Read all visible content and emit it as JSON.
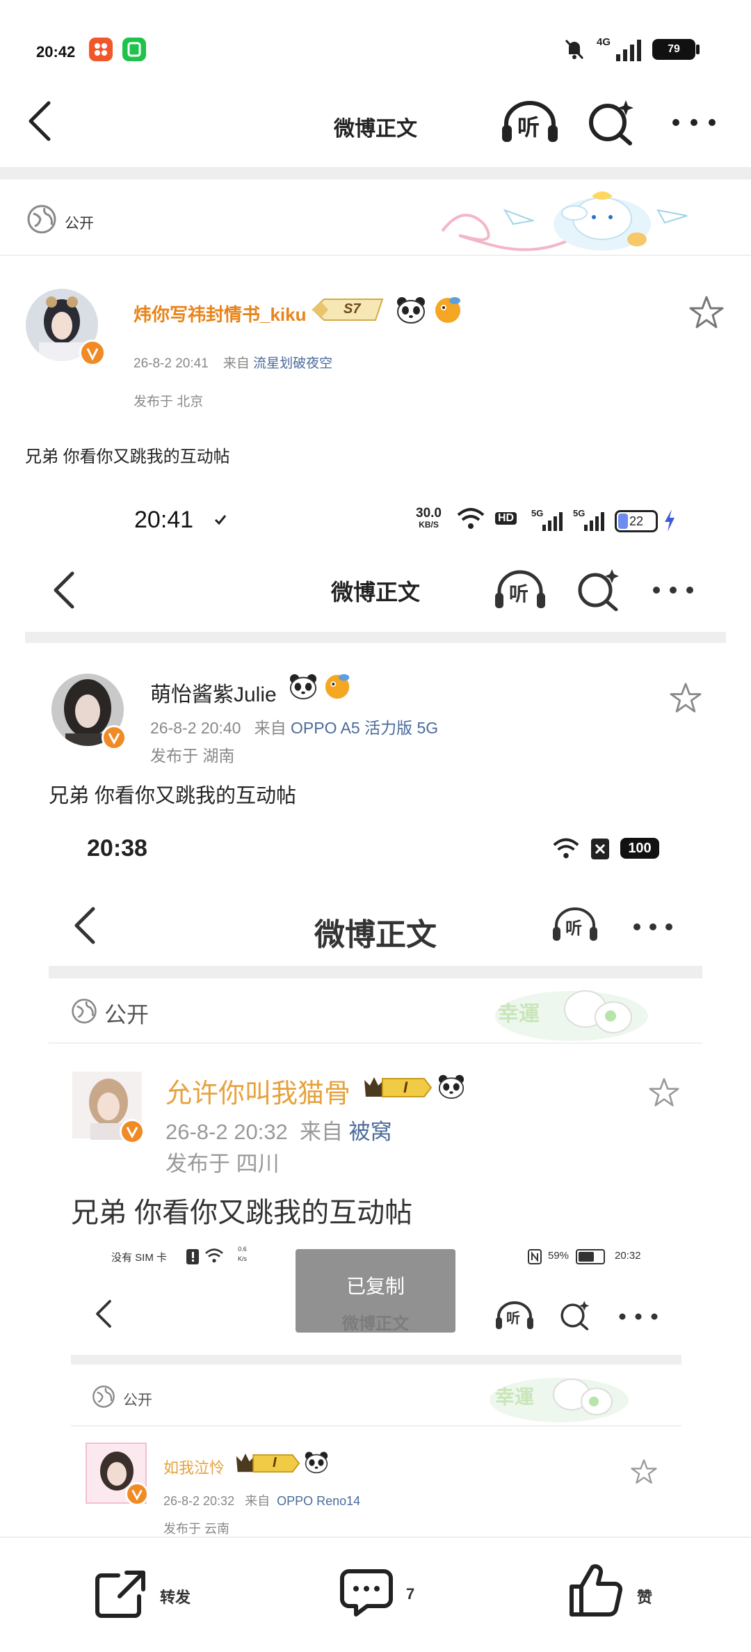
{
  "status_bar": {
    "time": "20:42",
    "network": "4G",
    "battery": "79"
  },
  "header": {
    "title": "微博正文",
    "listen_label": "听"
  },
  "visibility": {
    "label": "公开"
  },
  "post": {
    "author": "炜你写祎封情书_kiku",
    "level_badge": "S7",
    "date": "26-8-2 20:41",
    "from_label": "来自",
    "source": "流星划破夜空",
    "location": "发布于 北京",
    "text": "兄弟 你看你又跳我的互动帖"
  },
  "screenshot1": {
    "time": "20:41",
    "speed": "30.0",
    "speed_unit": "KB/S",
    "hd": "HD",
    "net1": "5G",
    "net2": "5G",
    "battery": "22",
    "title": "微博正文",
    "listen_label": "听",
    "author": "萌怡酱紫Julie",
    "date": "26-8-2 20:40",
    "from_label": "来自",
    "source": "OPPO A5 活力版 5G",
    "location": "发布于 湖南",
    "text": "兄弟 你看你又跳我的互动帖"
  },
  "screenshot2": {
    "time": "20:38",
    "battery": "100",
    "title": "微博正文",
    "listen_label": "听",
    "public_label": "公开",
    "sticker_text": "幸運",
    "author": "允许你叫我猫骨",
    "level_badge": "I",
    "date": "26-8-2 20:32",
    "from_label": "来自",
    "source": "被窝",
    "location": "发布于 四川",
    "text": "兄弟 你看你又跳我的互动帖"
  },
  "screenshot3": {
    "no_sim": "没有 SIM 卡",
    "speed": "0.6",
    "speed_unit": "K/s",
    "battery": "59%",
    "time": "20:32",
    "title": "微博正文",
    "listen_label": "听",
    "public_label": "公开",
    "sticker_text": "幸運",
    "author": "如我泣怜",
    "level_badge": "I",
    "date": "26-8-2 20:32",
    "from_label": "来自",
    "source": "OPPO Reno14",
    "location": "发布于 云南"
  },
  "toast": {
    "text": "已复制"
  },
  "bottom_bar": {
    "repost_label": "转发",
    "comment_count": "7",
    "like_label": "赞"
  },
  "colors": {
    "author_orange": "#e8841a",
    "link_blue": "#4a6a9b",
    "divider": "#eeeeee",
    "vip_badge": "#f08a24"
  }
}
